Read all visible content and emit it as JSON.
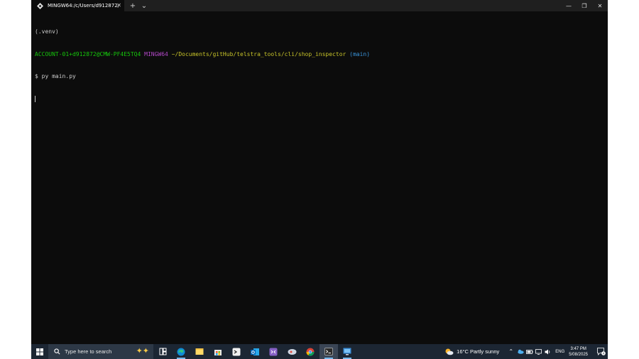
{
  "window": {
    "tab_title": "MINGW64:/c/Users/d912872/[",
    "new_tab_glyph": "+",
    "dropdown_glyph": "⌄",
    "close_tab_glyph": "✕"
  },
  "terminal": {
    "venv_line": "(.venv)",
    "user_host": "ACCOUNT-01+d912872@CMW-PF4E5TQ4",
    "shell_name": "MINGW64",
    "cwd": "~/Documents/gitHub/telstra_tools/cli/shop_inspector",
    "branch": "(main)",
    "prompt": "$",
    "command": "py main.py"
  },
  "taskbar": {
    "search_placeholder": "Type here to search",
    "apps": [
      {
        "icon": "task-view-icon",
        "name": "Task View"
      },
      {
        "icon": "edge-icon",
        "name": "Microsoft Edge"
      },
      {
        "icon": "file-explorer-icon",
        "name": "File Explorer"
      },
      {
        "icon": "store-icon",
        "name": "Microsoft Store"
      },
      {
        "icon": "terminal-app-icon",
        "name": "App"
      },
      {
        "icon": "outlook-icon",
        "name": "Outlook"
      },
      {
        "icon": "vs-icon",
        "name": "Visual Studio"
      },
      {
        "icon": "snip-icon",
        "name": "Snipping Tool"
      },
      {
        "icon": "chrome-icon",
        "name": "Chrome"
      },
      {
        "icon": "windows-terminal-icon",
        "name": "Terminal"
      },
      {
        "icon": "remote-desktop-icon",
        "name": "Remote Desktop"
      }
    ],
    "weather": "16°C  Partly sunny",
    "language": "ENG",
    "time": "3:47 PM",
    "date": "5/08/2025",
    "notification_count": "4"
  },
  "colors": {
    "terminal_bg": "#0c0c0c",
    "user_host": "#16c60c",
    "shell_name": "#b148c6",
    "cwd": "#c7c329",
    "branch": "#3a96dd",
    "taskbar_bg": "#1c2633"
  }
}
